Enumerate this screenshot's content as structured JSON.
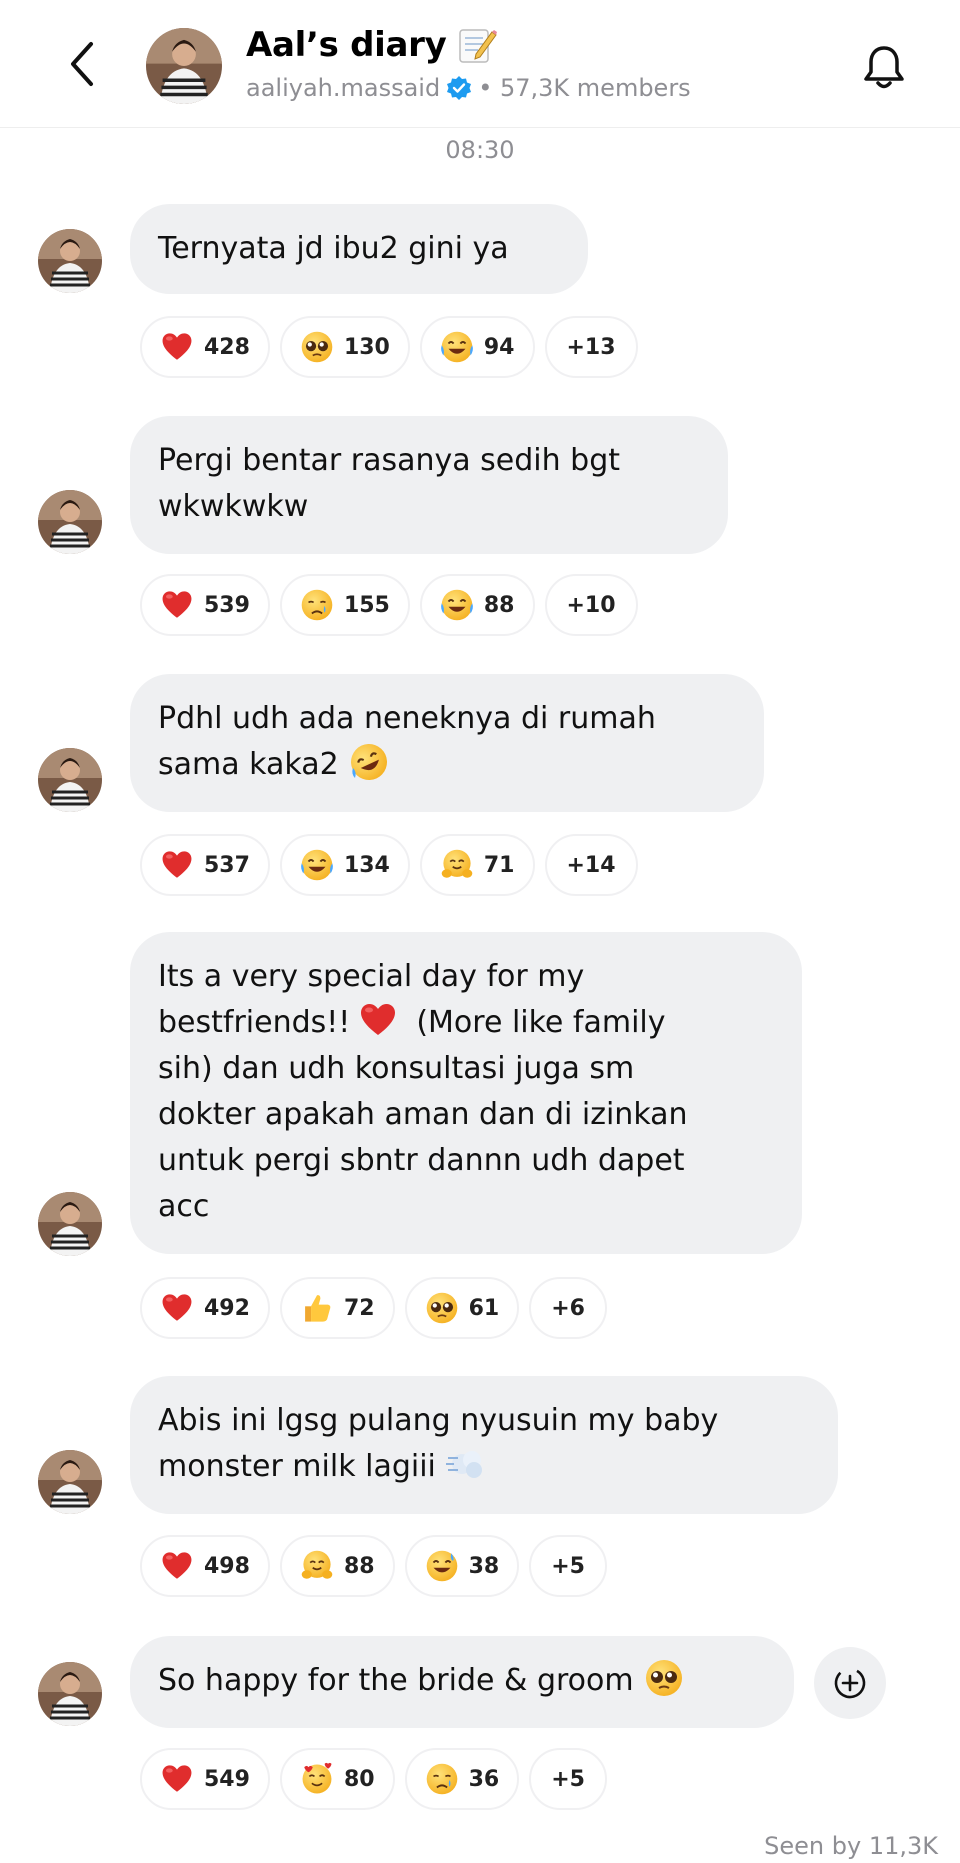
{
  "header": {
    "title": "Aal’s diary",
    "title_icon": "memo-icon",
    "username": "aaliyah.massaid",
    "verified": true,
    "members": "• 57,3K members",
    "accent": "#1d9bf0"
  },
  "timestamp": "08:30",
  "messages": [
    {
      "lines": [
        "Ternyata jd ibu2 gini ya"
      ],
      "reactions": [
        {
          "icon": "heart",
          "count": "428"
        },
        {
          "icon": "pleading",
          "count": "130"
        },
        {
          "icon": "joy",
          "count": "94"
        },
        {
          "more": "+13"
        }
      ]
    },
    {
      "lines": [
        "Pergi bentar rasanya sedih bgt",
        "wkwkwkw"
      ],
      "reactions": [
        {
          "icon": "heart",
          "count": "539"
        },
        {
          "icon": "crying",
          "count": "155"
        },
        {
          "icon": "joy",
          "count": "88"
        },
        {
          "more": "+10"
        }
      ]
    },
    {
      "lines": [
        "Pdhl udh ada neneknya di rumah",
        "sama kaka2"
      ],
      "emoji": "rofl",
      "reactions": [
        {
          "icon": "heart",
          "count": "537"
        },
        {
          "icon": "joy",
          "count": "134"
        },
        {
          "icon": "hug",
          "count": "71"
        },
        {
          "more": "+14"
        }
      ]
    },
    {
      "lines": [
        "Its a very special day for my",
        "bestfriends!!",
        "sih) dan udh konsultasi juga sm",
        "dokter apakah aman dan di izinkan",
        "untuk pergi sbntr dannn udh dapet",
        "acc"
      ],
      "inline_after_line_2": "(More like family",
      "reactions": [
        {
          "icon": "heart",
          "count": "492"
        },
        {
          "icon": "thumbs-up",
          "count": "72"
        },
        {
          "icon": "pleading",
          "count": "61"
        },
        {
          "more": "+6"
        }
      ]
    },
    {
      "lines": [
        "Abis ini lgsg pulang nyusuin my baby",
        "monster milk lagiii"
      ],
      "emoji": "dash",
      "reactions": [
        {
          "icon": "heart",
          "count": "498"
        },
        {
          "icon": "hug",
          "count": "88"
        },
        {
          "icon": "sweat-smile",
          "count": "38"
        },
        {
          "more": "+5"
        }
      ]
    },
    {
      "lines": [
        "So happy for the bride & groom"
      ],
      "emoji": "pleading",
      "reactions": [
        {
          "icon": "heart",
          "count": "549"
        },
        {
          "icon": "smiling-hearts",
          "count": "80"
        },
        {
          "icon": "crying",
          "count": "36"
        },
        {
          "more": "+5"
        }
      ]
    }
  ],
  "seen_by": "Seen by 11,3K",
  "colors": {
    "bubble": "#eff0f2",
    "muted": "#8e8e93",
    "heart": "#e0245e"
  }
}
